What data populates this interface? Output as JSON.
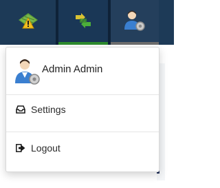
{
  "topbar": {
    "tabs": [
      {
        "icon": "alert-map-icon"
      },
      {
        "icon": "sync-arrows-icon"
      },
      {
        "icon": "user-settings-icon"
      }
    ]
  },
  "user_menu": {
    "user_name": "Admin Admin",
    "avatar_icon": "user-gear-icon",
    "items": [
      {
        "label": "Settings",
        "icon": "inbox-icon"
      },
      {
        "label": "Logout",
        "icon": "logout-icon"
      }
    ]
  }
}
